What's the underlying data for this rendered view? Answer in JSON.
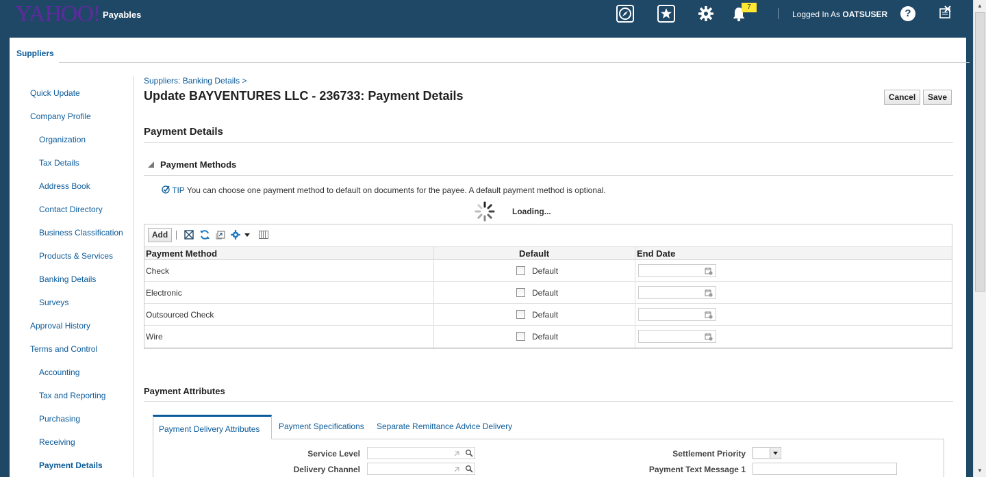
{
  "header": {
    "logo": "YAHOO!",
    "app_name": "Payables",
    "notification_count": "7",
    "logged_in_prefix": "Logged In As",
    "user": "OATSUSER",
    "help": "?"
  },
  "tabs": {
    "suppliers": "Suppliers"
  },
  "sidebar": {
    "items": [
      {
        "label": "Quick Update",
        "level": 0
      },
      {
        "label": "Company Profile",
        "level": 0
      },
      {
        "label": "Organization",
        "level": 1
      },
      {
        "label": "Tax Details",
        "level": 1
      },
      {
        "label": "Address Book",
        "level": 1
      },
      {
        "label": "Contact Directory",
        "level": 1
      },
      {
        "label": "Business Classification",
        "level": 1
      },
      {
        "label": "Products & Services",
        "level": 1
      },
      {
        "label": "Banking Details",
        "level": 1
      },
      {
        "label": "Surveys",
        "level": 1
      },
      {
        "label": "Approval History",
        "level": 0
      },
      {
        "label": "Terms and Control",
        "level": 0
      },
      {
        "label": "Accounting",
        "level": 1
      },
      {
        "label": "Tax and Reporting",
        "level": 1
      },
      {
        "label": "Purchasing",
        "level": 1
      },
      {
        "label": "Receiving",
        "level": 1
      },
      {
        "label": "Payment Details",
        "level": 1,
        "active": true
      }
    ]
  },
  "main": {
    "breadcrumb": "Suppliers: Banking Details  >",
    "title": "Update BAYVENTURES LLC - 236733: Payment Details",
    "cancel_label": "Cancel",
    "save_label": "Save",
    "section_title": "Payment Details",
    "subsection_title": "Payment Methods",
    "tip_label": "TIP",
    "tip_text": "You can choose one payment method to default on documents for the payee. A default payment method is optional.",
    "loading_text": "Loading...",
    "add_label": "Add",
    "table": {
      "columns": [
        "Payment Method",
        "Default",
        "End Date"
      ],
      "rows": [
        {
          "method": "Check",
          "default_label": "Default",
          "end_date": ""
        },
        {
          "method": "Electronic",
          "default_label": "Default",
          "end_date": ""
        },
        {
          "method": "Outsourced Check",
          "default_label": "Default",
          "end_date": ""
        },
        {
          "method": "Wire",
          "default_label": "Default",
          "end_date": ""
        }
      ]
    },
    "attributes": {
      "title": "Payment Attributes",
      "tabs": [
        "Payment Delivery Attributes",
        "Payment Specifications",
        "Separate Remittance Advice Delivery"
      ],
      "fields": {
        "service_level": "Service Level",
        "delivery_channel": "Delivery Channel",
        "settlement_priority": "Settlement Priority",
        "payment_text_message_1": "Payment Text Message 1"
      }
    }
  },
  "colors": {
    "header_bg": "#1f4766",
    "link": "#0b5b9a",
    "logo": "#5f2a9f",
    "badge": "#ffe733"
  },
  "icons": [
    "compass-icon",
    "star-icon",
    "gear-icon",
    "bell-icon",
    "help-icon",
    "close-window-icon",
    "freeze-icon",
    "refresh-icon",
    "detach-icon",
    "settings-icon",
    "columns-icon",
    "calendar-icon",
    "search-icon",
    "spinner-icon",
    "collapse-triangle-icon",
    "tip-check-icon"
  ]
}
